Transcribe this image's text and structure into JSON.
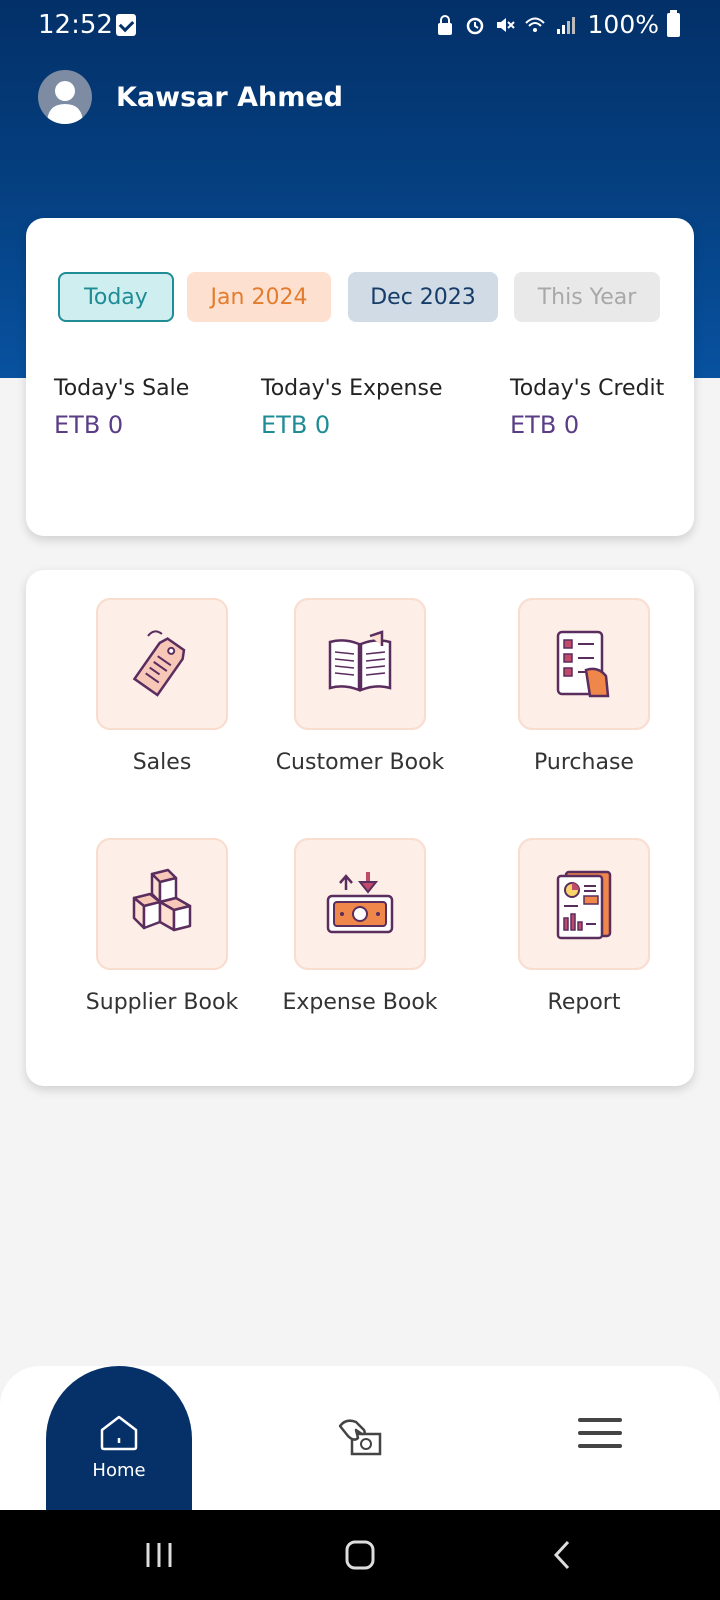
{
  "status_bar": {
    "time": "12:52",
    "battery": "100%"
  },
  "user": {
    "name": "Kawsar Ahmed"
  },
  "period_tabs": [
    {
      "label": "Today",
      "state": "selected"
    },
    {
      "label": "Jan 2024"
    },
    {
      "label": "Dec 2023"
    },
    {
      "label": "This Year",
      "state": "disabled"
    }
  ],
  "stats": [
    {
      "label": "Today's Sale",
      "value": "ETB 0"
    },
    {
      "label": "Today's Expense",
      "value": "ETB 0"
    },
    {
      "label": "Today's Credit",
      "value": "ETB 0"
    }
  ],
  "menu": [
    {
      "label": "Sales",
      "icon": "price-tag-icon"
    },
    {
      "label": "Customer Book",
      "icon": "open-book-icon"
    },
    {
      "label": "Purchase",
      "icon": "checklist-hand-icon"
    },
    {
      "label": "Supplier Book",
      "icon": "boxes-icon"
    },
    {
      "label": "Expense Book",
      "icon": "money-transfer-icon"
    },
    {
      "label": "Report",
      "icon": "report-document-icon"
    }
  ],
  "bottom_nav": {
    "home_label": "Home",
    "cash_icon": "hand-money-icon",
    "menu_icon": "hamburger-menu-icon"
  },
  "colors": {
    "header": "#033068",
    "accent_teal": "#1e8c95",
    "accent_orange": "#e37c2d",
    "accent_purple": "#5a3d86",
    "icon_tile": "#fdeee7"
  }
}
